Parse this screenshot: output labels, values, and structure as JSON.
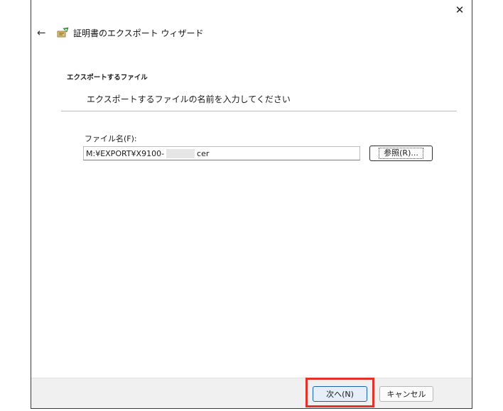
{
  "window": {
    "title": "証明書のエクスポート ウィザード",
    "close_glyph": "✕",
    "back_glyph": "←"
  },
  "section": {
    "heading": "エクスポートするファイル",
    "description": "エクスポートするファイルの名前を入力してください"
  },
  "file": {
    "label": "ファイル名(F):",
    "value_prefix": "M:¥EXPORT¥X9100-",
    "value_suffix": "cer"
  },
  "buttons": {
    "browse": "参照(R)...",
    "next": "次へ(N)",
    "cancel": "キャンセル"
  },
  "colors": {
    "highlight": "#e0332b",
    "default_button_border": "#1f5fb0"
  },
  "icons": {
    "back": "arrow-left-icon",
    "wizard": "certificate-wizard-icon",
    "close": "close-icon"
  }
}
